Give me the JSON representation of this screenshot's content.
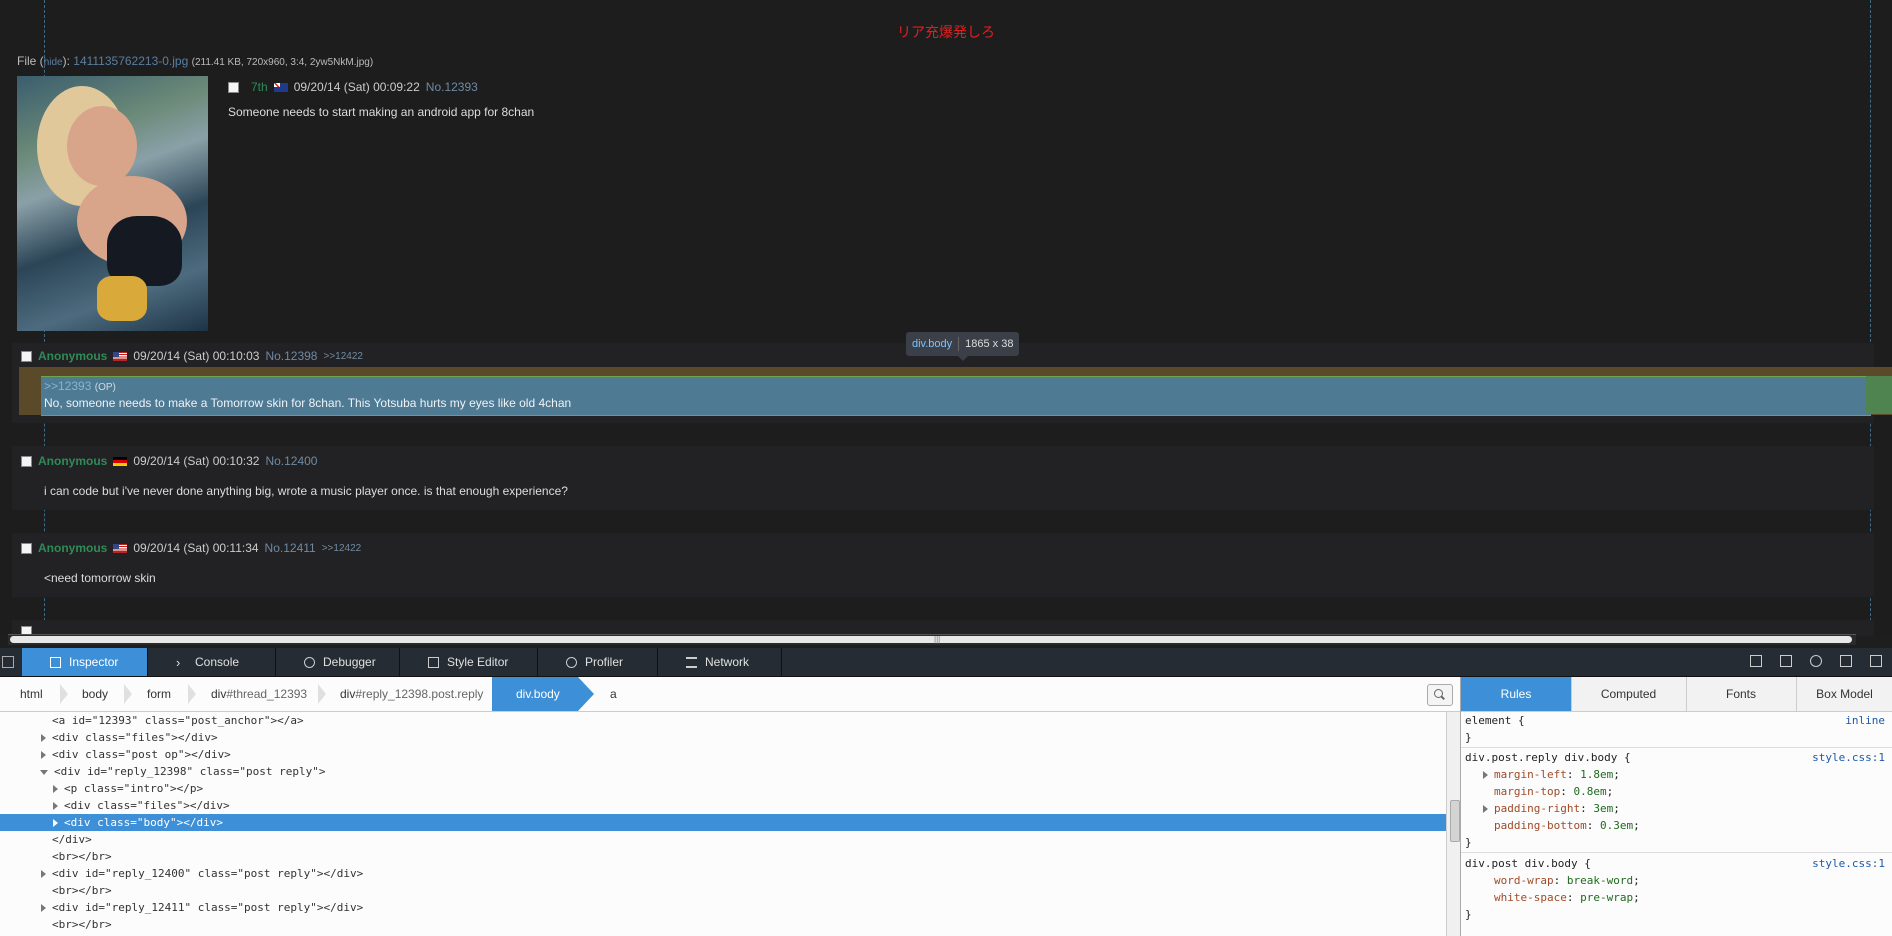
{
  "page": {
    "banner": "リア充爆発しろ",
    "file": {
      "label": "File",
      "hide": "hide",
      "name": "1411135762213-0.jpg",
      "meta": "(211.41 KB, 720x960, 3:4, 2yw5NkM.jpg)"
    },
    "op": {
      "trip": "7th",
      "date": "09/20/14 (Sat) 00:09:22",
      "no": "No.12393",
      "body": "Someone needs to start making an android app for 8chan"
    },
    "replies": [
      {
        "name": "Anonymous",
        "flag": "us",
        "date": "09/20/14 (Sat) 00:10:03",
        "no": "No.12398",
        "backlink": ">>12422",
        "quote": ">>12393",
        "quote_suffix": "(OP)",
        "body": "No, someone needs to make a Tomorrow skin for 8chan. This Yotsuba hurts my eyes like old 4chan"
      },
      {
        "name": "Anonymous",
        "flag": "de",
        "date": "09/20/14 (Sat) 00:10:32",
        "no": "No.12400",
        "body": "i can code but i've never done anything big, wrote a music player once. is that enough experience?"
      },
      {
        "name": "Anonymous",
        "flag": "us",
        "date": "09/20/14 (Sat) 00:11:34",
        "no": "No.12411",
        "backlink": ">>12422",
        "body": "<need tomorrow skin"
      }
    ],
    "tooltip": {
      "tag": "div.body",
      "dims": "1865 x 38"
    }
  },
  "devtools": {
    "tabs": [
      "Inspector",
      "Console",
      "Debugger",
      "Style Editor",
      "Profiler",
      "Network"
    ],
    "breadcrumbs": [
      {
        "tag": "html",
        "cls": ""
      },
      {
        "tag": "body",
        "cls": ""
      },
      {
        "tag": "form",
        "cls": ""
      },
      {
        "tag": "div",
        "cls": "#thread_12393"
      },
      {
        "tag": "div",
        "cls": "#reply_12398.post.reply"
      },
      {
        "tag": "div",
        "cls": ".body"
      },
      {
        "tag": "a",
        "cls": ""
      }
    ],
    "markup": [
      "<a id=\"12393\" class=\"post_anchor\"></a>",
      "<div class=\"files\"></div>",
      "<div class=\"post op\"></div>",
      "<div id=\"reply_12398\" class=\"post reply\">",
      "<p class=\"intro\"></p>",
      "<div class=\"files\"></div>",
      "<div class=\"body\"></div>",
      "</div>",
      "<br></br>",
      "<div id=\"reply_12400\" class=\"post reply\"></div>",
      "<br></br>",
      "<div id=\"reply_12411\" class=\"post reply\"></div>",
      "<br></br>"
    ],
    "side_tabs": [
      "Rules",
      "Computed",
      "Fonts",
      "Box Model"
    ],
    "rules": {
      "element_sel": "element {",
      "element_src": "inline",
      "close": "}",
      "r1_sel": "div.post.reply div.body {",
      "r1_src": "style.css:1",
      "r1_props": [
        {
          "name": "margin-left",
          "value": "1.8em"
        },
        {
          "name": "margin-top",
          "value": "0.8em"
        },
        {
          "name": "padding-right",
          "value": "3em"
        },
        {
          "name": "padding-bottom",
          "value": "0.3em"
        }
      ],
      "r2_sel": "div.post div.body {",
      "r2_src": "style.css:1",
      "r2_props": [
        {
          "name": "word-wrap",
          "value": "break-word"
        },
        {
          "name": "white-space",
          "value": "pre-wrap"
        }
      ]
    }
  }
}
